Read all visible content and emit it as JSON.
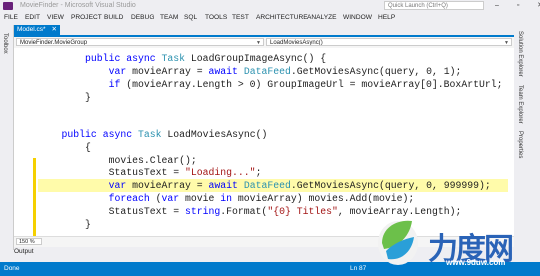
{
  "window": {
    "title": "MovieFinder - Microsoft Visual Studio",
    "quick_launch_placeholder": "Quick Launch (Ctrl+Q)",
    "window_controls": "– ▫ ✕"
  },
  "menu": [
    "FILE",
    "EDIT",
    "VIEW",
    "PROJECT",
    "BUILD",
    "DEBUG",
    "TEAM",
    "SQL",
    "TOOLS",
    "TEST",
    "ARCHITECTURE",
    "ANALYZE",
    "WINDOW",
    "HELP"
  ],
  "toolbox_label": "Toolbox",
  "right_panels": [
    "Solution Explorer",
    "Team Explorer",
    "Properties"
  ],
  "doc_tab": {
    "label": "Model.cs*",
    "close": "✕"
  },
  "nav": {
    "class_box": "MovieFinder.MovieGroup",
    "member_box": "LoadMoviesAsync()"
  },
  "code": {
    "line1": {
      "indent": "        ",
      "kw1": "public",
      "kw2": "async",
      "ty": "Task",
      "rest": " LoadGroupImageAsync() {"
    },
    "line2": {
      "indent": "            ",
      "kw": "var",
      "mid": " movieArray = ",
      "kw2": "await",
      "ty": "DataFeed",
      "rest": ".GetMoviesAsync(query, 0, 1);"
    },
    "line3": {
      "indent": "            ",
      "kw": "if",
      "rest": " (movieArray.Length > 0) GroupImageUrl = movieArray[0].BoxArtUrl;"
    },
    "line4": {
      "indent": "        ",
      "rest": "}"
    },
    "line5": {
      "indent": "    ",
      "kw1": "public",
      "kw2": "async",
      "ty": "Task",
      "rest": " LoadMoviesAsync()"
    },
    "line6": {
      "indent": "        ",
      "rest": "{"
    },
    "line7": {
      "indent": "            ",
      "rest": "movies.Clear();"
    },
    "line8": {
      "indent": "            ",
      "pre": "StatusText = ",
      "str": "\"Loading...\"",
      "rest": ";"
    },
    "line9": {
      "indent": "            ",
      "kw": "var",
      "mid": " movieArray = ",
      "kw2": "await",
      "ty": "DataFeed",
      "rest": ".GetMoviesAsync(query, 0, 999999);"
    },
    "line10": {
      "indent": "            ",
      "kw": "foreach",
      "pre": " (",
      "kw2": "var",
      "mid": " movie ",
      "kw3": "in",
      "rest": " movieArray) movies.Add(movie);"
    },
    "line11": {
      "indent": "            ",
      "pre": "StatusText = ",
      "kw": "string",
      "mid": ".Format(",
      "str": "\"{0} Titles\"",
      "rest": ", movieArray.Length);"
    },
    "line12": {
      "indent": "        ",
      "rest": "}"
    }
  },
  "zoom": "150 %",
  "output_tab": "Output",
  "status": {
    "state": "Done",
    "line": "Ln 87"
  },
  "watermark": {
    "text": "力度网",
    "url": "www.9duw.com"
  },
  "colors": {
    "accent": "#007acc",
    "keyword": "#0000ff",
    "type": "#2b91af",
    "string": "#a31515",
    "highlight": "#fffbaa"
  }
}
